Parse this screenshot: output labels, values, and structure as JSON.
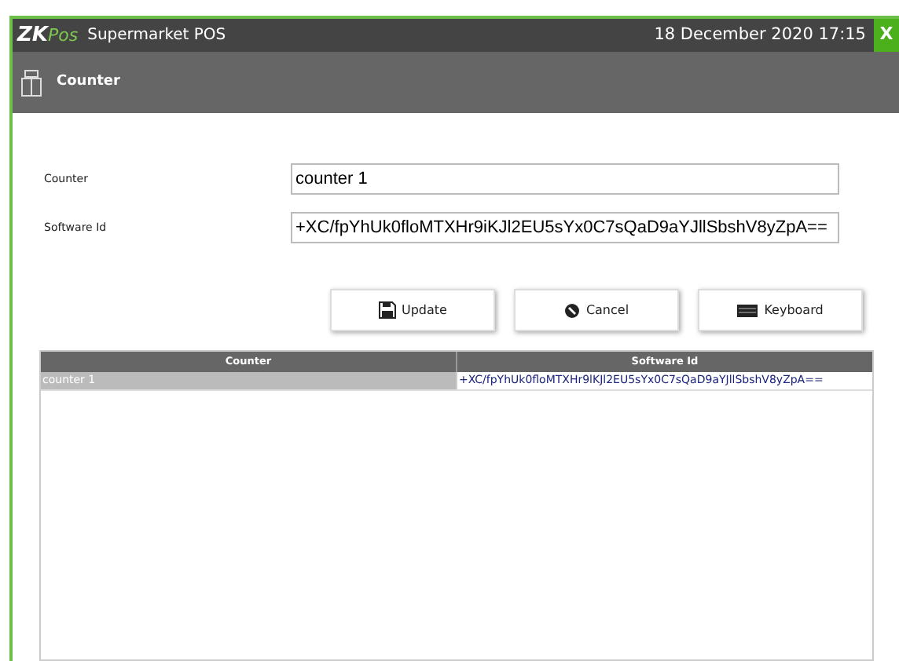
{
  "window": {
    "logo_main": "ZK",
    "logo_sub": "Pos",
    "title": "Supermarket POS",
    "datetime": "18 December 2020 17:15",
    "close": "X"
  },
  "header": {
    "title": "Counter"
  },
  "form": [
    {
      "label": "Counter",
      "value": "counter 1"
    },
    {
      "label": "Software Id",
      "value": "+XC/fpYhUk0floMTXHr9iKJl2EU5sYx0C7sQaD9aYJllSbshV8yZpA=="
    }
  ],
  "buttons": [
    {
      "kind": "save",
      "label": "Update"
    },
    {
      "kind": "cancel",
      "label": "Cancel"
    },
    {
      "kind": "keyboard",
      "label": "Keyboard"
    }
  ],
  "table": {
    "columns": [
      "Counter",
      "Software Id"
    ],
    "rows": [
      {
        "selected": true,
        "cells": [
          "counter 1",
          "+XC/fpYhUk0floMTXHr9lKJl2EU5sYx0C7sQaD9aYJllSbshV8yZpA=="
        ]
      }
    ]
  }
}
